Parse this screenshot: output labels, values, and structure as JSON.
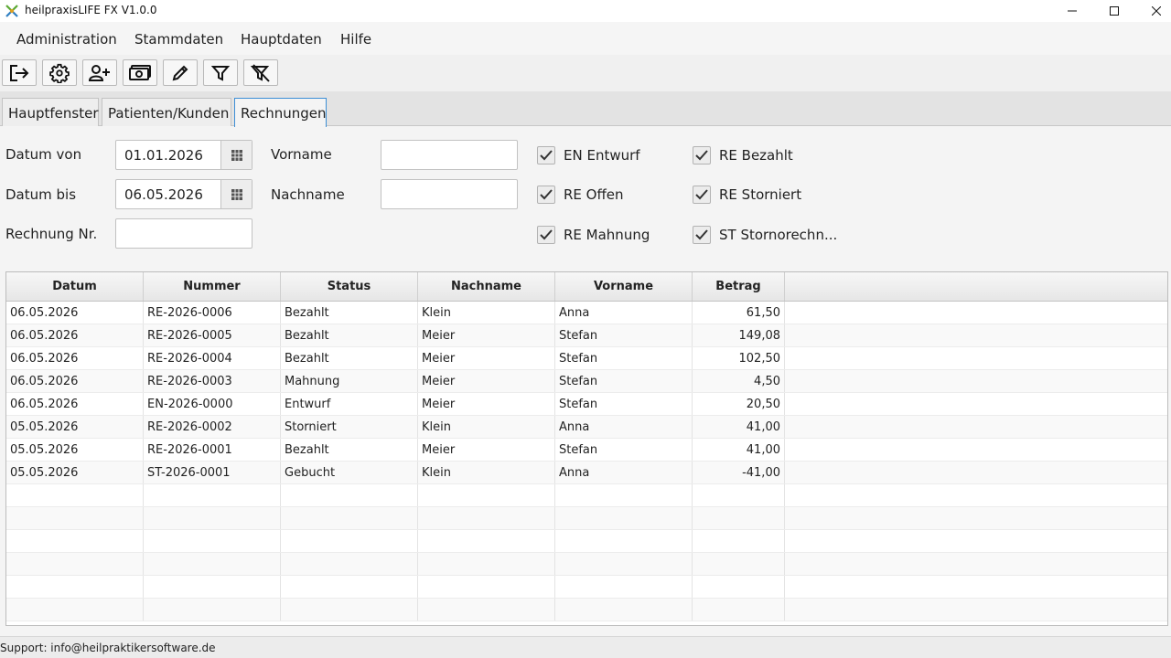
{
  "window": {
    "title": "heilpraxisLIFE FX V1.0.0",
    "controls": [
      "minimize-icon",
      "maximize-icon",
      "close-icon"
    ]
  },
  "menu": {
    "items": [
      "Administration",
      "Stammdaten",
      "Hauptdaten",
      "Hilfe"
    ]
  },
  "toolbar": {
    "buttons": [
      "logout-icon",
      "settings-gear-icon",
      "add-person-icon",
      "money-icon",
      "edit-pencil-icon",
      "filter-icon",
      "clear-filter-icon"
    ]
  },
  "tabs": {
    "items": [
      "Hauptfenster",
      "Patienten/Kunden",
      "Rechnungen"
    ],
    "active": "Rechnungen"
  },
  "filter": {
    "datum_von_label": "Datum von",
    "datum_von_value": "01.01.2026",
    "datum_bis_label": "Datum bis",
    "datum_bis_value": "06.05.2026",
    "rechnung_nr_label": "Rechnung Nr.",
    "rechnung_nr_value": "",
    "vorname_label": "Vorname",
    "vorname_value": "",
    "nachname_label": "Nachname",
    "nachname_value": "",
    "checks": [
      {
        "label": "EN Entwurf",
        "checked": true
      },
      {
        "label": "RE Offen",
        "checked": true
      },
      {
        "label": "RE Mahnung",
        "checked": true
      },
      {
        "label": "RE Bezahlt",
        "checked": true
      },
      {
        "label": "RE Storniert",
        "checked": true
      },
      {
        "label": "ST Stornorechn...",
        "checked": true
      }
    ]
  },
  "table": {
    "columns": [
      "Datum",
      "Nummer",
      "Status",
      "Nachname",
      "Vorname",
      "Betrag"
    ],
    "rows": [
      [
        "06.05.2026",
        "RE-2026-0006",
        "Bezahlt",
        "Klein",
        "Anna",
        "61,50"
      ],
      [
        "06.05.2026",
        "RE-2026-0005",
        "Bezahlt",
        "Meier",
        "Stefan",
        "149,08"
      ],
      [
        "06.05.2026",
        "RE-2026-0004",
        "Bezahlt",
        "Meier",
        "Stefan",
        "102,50"
      ],
      [
        "06.05.2026",
        "RE-2026-0003",
        "Mahnung",
        "Meier",
        "Stefan",
        "4,50"
      ],
      [
        "06.05.2026",
        "EN-2026-0000",
        "Entwurf",
        "Meier",
        "Stefan",
        "20,50"
      ],
      [
        "05.05.2026",
        "RE-2026-0002",
        "Storniert",
        "Klein",
        "Anna",
        "41,00"
      ],
      [
        "05.05.2026",
        "RE-2026-0001",
        "Bezahlt",
        "Meier",
        "Stefan",
        "41,00"
      ],
      [
        "05.05.2026",
        "ST-2026-0001",
        "Gebucht",
        "Klein",
        "Anna",
        "-41,00"
      ]
    ]
  },
  "status_bar": {
    "text": "Support: info@heilpraktikersoftware.de"
  },
  "colors": {
    "active_tab_border": "#3d8fd6",
    "app_icon": "#4caf50"
  }
}
